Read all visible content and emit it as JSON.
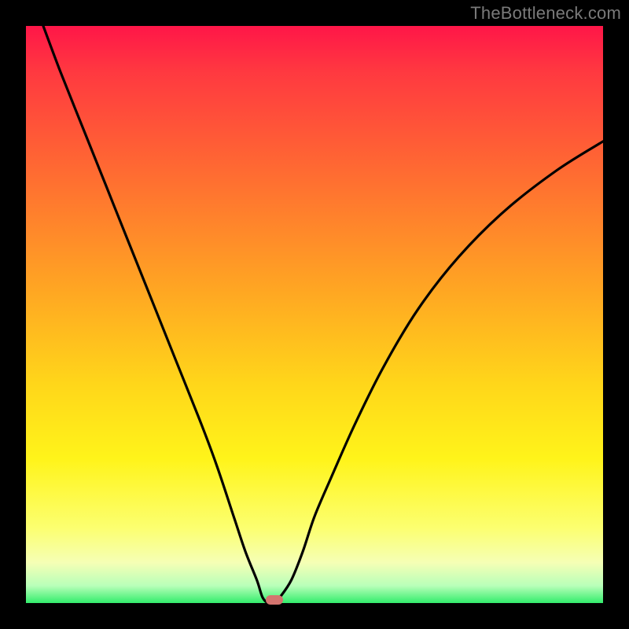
{
  "watermark": "TheBottleneck.com",
  "chart_data": {
    "type": "line",
    "title": "",
    "xlabel": "",
    "ylabel": "",
    "xlim": [
      0,
      100
    ],
    "ylim": [
      0,
      100
    ],
    "legend": false,
    "grid": false,
    "series": [
      {
        "name": "bottleneck-curve",
        "x": [
          3,
          6,
          10,
          14,
          18,
          22,
          26,
          30,
          33,
          36,
          38,
          40,
          41,
          42,
          43,
          44,
          46,
          48,
          50,
          53,
          57,
          62,
          68,
          75,
          83,
          92,
          100
        ],
        "values": [
          100,
          92,
          82,
          72,
          62,
          52,
          42,
          32,
          24,
          15,
          9,
          4,
          1,
          0,
          0,
          1,
          4,
          9,
          15,
          22,
          31,
          41,
          51,
          60,
          68,
          75,
          80
        ]
      }
    ],
    "annotations": [
      {
        "name": "min-marker",
        "x": 43,
        "y": 0,
        "color": "#d4746f"
      }
    ],
    "background_gradient": {
      "top": "#ff1648",
      "upper_mid": "#ffa423",
      "mid": "#fff41a",
      "lower": "#33ed6c"
    }
  }
}
